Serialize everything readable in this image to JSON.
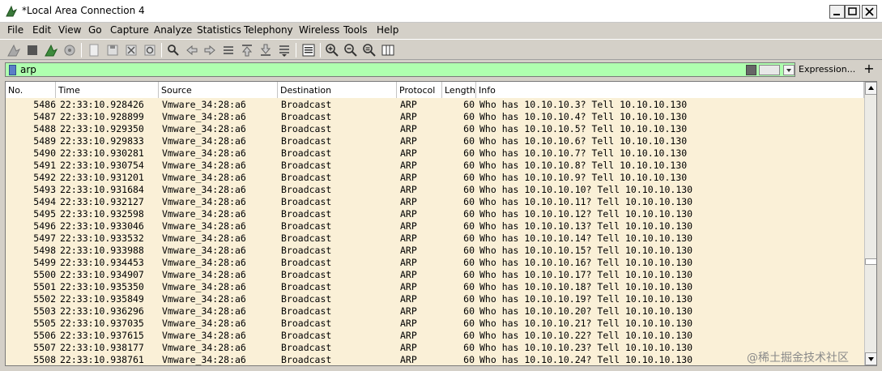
{
  "window": {
    "title": "*Local Area Connection 4"
  },
  "menu": [
    "File",
    "Edit",
    "View",
    "Go",
    "Capture",
    "Analyze",
    "Statistics",
    "Telephony",
    "Wireless",
    "Tools",
    "Help"
  ],
  "filter": {
    "value": "arp",
    "expression_label": "Expression...",
    "add_label": "+"
  },
  "columns": [
    "No.",
    "Time",
    "Source",
    "Destination",
    "Protocol",
    "Length",
    "Info"
  ],
  "packets": [
    {
      "no": "5486",
      "time": "22:33:10.928426",
      "src": "Vmware_34:28:a6",
      "dst": "Broadcast",
      "proto": "ARP",
      "len": "60",
      "info": "Who has 10.10.10.3? Tell 10.10.10.130"
    },
    {
      "no": "5487",
      "time": "22:33:10.928899",
      "src": "Vmware_34:28:a6",
      "dst": "Broadcast",
      "proto": "ARP",
      "len": "60",
      "info": "Who has 10.10.10.4? Tell 10.10.10.130"
    },
    {
      "no": "5488",
      "time": "22:33:10.929350",
      "src": "Vmware_34:28:a6",
      "dst": "Broadcast",
      "proto": "ARP",
      "len": "60",
      "info": "Who has 10.10.10.5? Tell 10.10.10.130"
    },
    {
      "no": "5489",
      "time": "22:33:10.929833",
      "src": "Vmware_34:28:a6",
      "dst": "Broadcast",
      "proto": "ARP",
      "len": "60",
      "info": "Who has 10.10.10.6? Tell 10.10.10.130"
    },
    {
      "no": "5490",
      "time": "22:33:10.930281",
      "src": "Vmware_34:28:a6",
      "dst": "Broadcast",
      "proto": "ARP",
      "len": "60",
      "info": "Who has 10.10.10.7? Tell 10.10.10.130"
    },
    {
      "no": "5491",
      "time": "22:33:10.930754",
      "src": "Vmware_34:28:a6",
      "dst": "Broadcast",
      "proto": "ARP",
      "len": "60",
      "info": "Who has 10.10.10.8? Tell 10.10.10.130"
    },
    {
      "no": "5492",
      "time": "22:33:10.931201",
      "src": "Vmware_34:28:a6",
      "dst": "Broadcast",
      "proto": "ARP",
      "len": "60",
      "info": "Who has 10.10.10.9? Tell 10.10.10.130"
    },
    {
      "no": "5493",
      "time": "22:33:10.931684",
      "src": "Vmware_34:28:a6",
      "dst": "Broadcast",
      "proto": "ARP",
      "len": "60",
      "info": "Who has 10.10.10.10? Tell 10.10.10.130"
    },
    {
      "no": "5494",
      "time": "22:33:10.932127",
      "src": "Vmware_34:28:a6",
      "dst": "Broadcast",
      "proto": "ARP",
      "len": "60",
      "info": "Who has 10.10.10.11? Tell 10.10.10.130"
    },
    {
      "no": "5495",
      "time": "22:33:10.932598",
      "src": "Vmware_34:28:a6",
      "dst": "Broadcast",
      "proto": "ARP",
      "len": "60",
      "info": "Who has 10.10.10.12? Tell 10.10.10.130"
    },
    {
      "no": "5496",
      "time": "22:33:10.933046",
      "src": "Vmware_34:28:a6",
      "dst": "Broadcast",
      "proto": "ARP",
      "len": "60",
      "info": "Who has 10.10.10.13? Tell 10.10.10.130"
    },
    {
      "no": "5497",
      "time": "22:33:10.933532",
      "src": "Vmware_34:28:a6",
      "dst": "Broadcast",
      "proto": "ARP",
      "len": "60",
      "info": "Who has 10.10.10.14? Tell 10.10.10.130"
    },
    {
      "no": "5498",
      "time": "22:33:10.933988",
      "src": "Vmware_34:28:a6",
      "dst": "Broadcast",
      "proto": "ARP",
      "len": "60",
      "info": "Who has 10.10.10.15? Tell 10.10.10.130"
    },
    {
      "no": "5499",
      "time": "22:33:10.934453",
      "src": "Vmware_34:28:a6",
      "dst": "Broadcast",
      "proto": "ARP",
      "len": "60",
      "info": "Who has 10.10.10.16? Tell 10.10.10.130"
    },
    {
      "no": "5500",
      "time": "22:33:10.934907",
      "src": "Vmware_34:28:a6",
      "dst": "Broadcast",
      "proto": "ARP",
      "len": "60",
      "info": "Who has 10.10.10.17? Tell 10.10.10.130"
    },
    {
      "no": "5501",
      "time": "22:33:10.935350",
      "src": "Vmware_34:28:a6",
      "dst": "Broadcast",
      "proto": "ARP",
      "len": "60",
      "info": "Who has 10.10.10.18? Tell 10.10.10.130"
    },
    {
      "no": "5502",
      "time": "22:33:10.935849",
      "src": "Vmware_34:28:a6",
      "dst": "Broadcast",
      "proto": "ARP",
      "len": "60",
      "info": "Who has 10.10.10.19? Tell 10.10.10.130"
    },
    {
      "no": "5503",
      "time": "22:33:10.936296",
      "src": "Vmware_34:28:a6",
      "dst": "Broadcast",
      "proto": "ARP",
      "len": "60",
      "info": "Who has 10.10.10.20? Tell 10.10.10.130"
    },
    {
      "no": "5505",
      "time": "22:33:10.937035",
      "src": "Vmware_34:28:a6",
      "dst": "Broadcast",
      "proto": "ARP",
      "len": "60",
      "info": "Who has 10.10.10.21? Tell 10.10.10.130"
    },
    {
      "no": "5506",
      "time": "22:33:10.937615",
      "src": "Vmware_34:28:a6",
      "dst": "Broadcast",
      "proto": "ARP",
      "len": "60",
      "info": "Who has 10.10.10.22? Tell 10.10.10.130"
    },
    {
      "no": "5507",
      "time": "22:33:10.938177",
      "src": "Vmware_34:28:a6",
      "dst": "Broadcast",
      "proto": "ARP",
      "len": "60",
      "info": "Who has 10.10.10.23? Tell 10.10.10.130"
    },
    {
      "no": "5508",
      "time": "22:33:10.938761",
      "src": "Vmware_34:28:a6",
      "dst": "Broadcast",
      "proto": "ARP",
      "len": "60",
      "info": "Who has 10.10.10.24? Tell 10.10.10.130"
    }
  ],
  "watermark": "@稀土掘金技术社区",
  "colors": {
    "filter_valid": "#afffaf",
    "row_bg": "#faf0d7"
  },
  "icons": [
    "shark-fin-icon",
    "stop-icon",
    "restart-icon",
    "options-icon",
    "open-icon",
    "save-icon",
    "close-file-icon",
    "reload-icon",
    "find-icon",
    "back-icon",
    "forward-icon",
    "goto-icon",
    "first-icon",
    "last-icon",
    "autoscroll-icon",
    "colorize-icon",
    "zoom-in-icon",
    "zoom-out-icon",
    "zoom-reset-icon",
    "resize-columns-icon"
  ]
}
